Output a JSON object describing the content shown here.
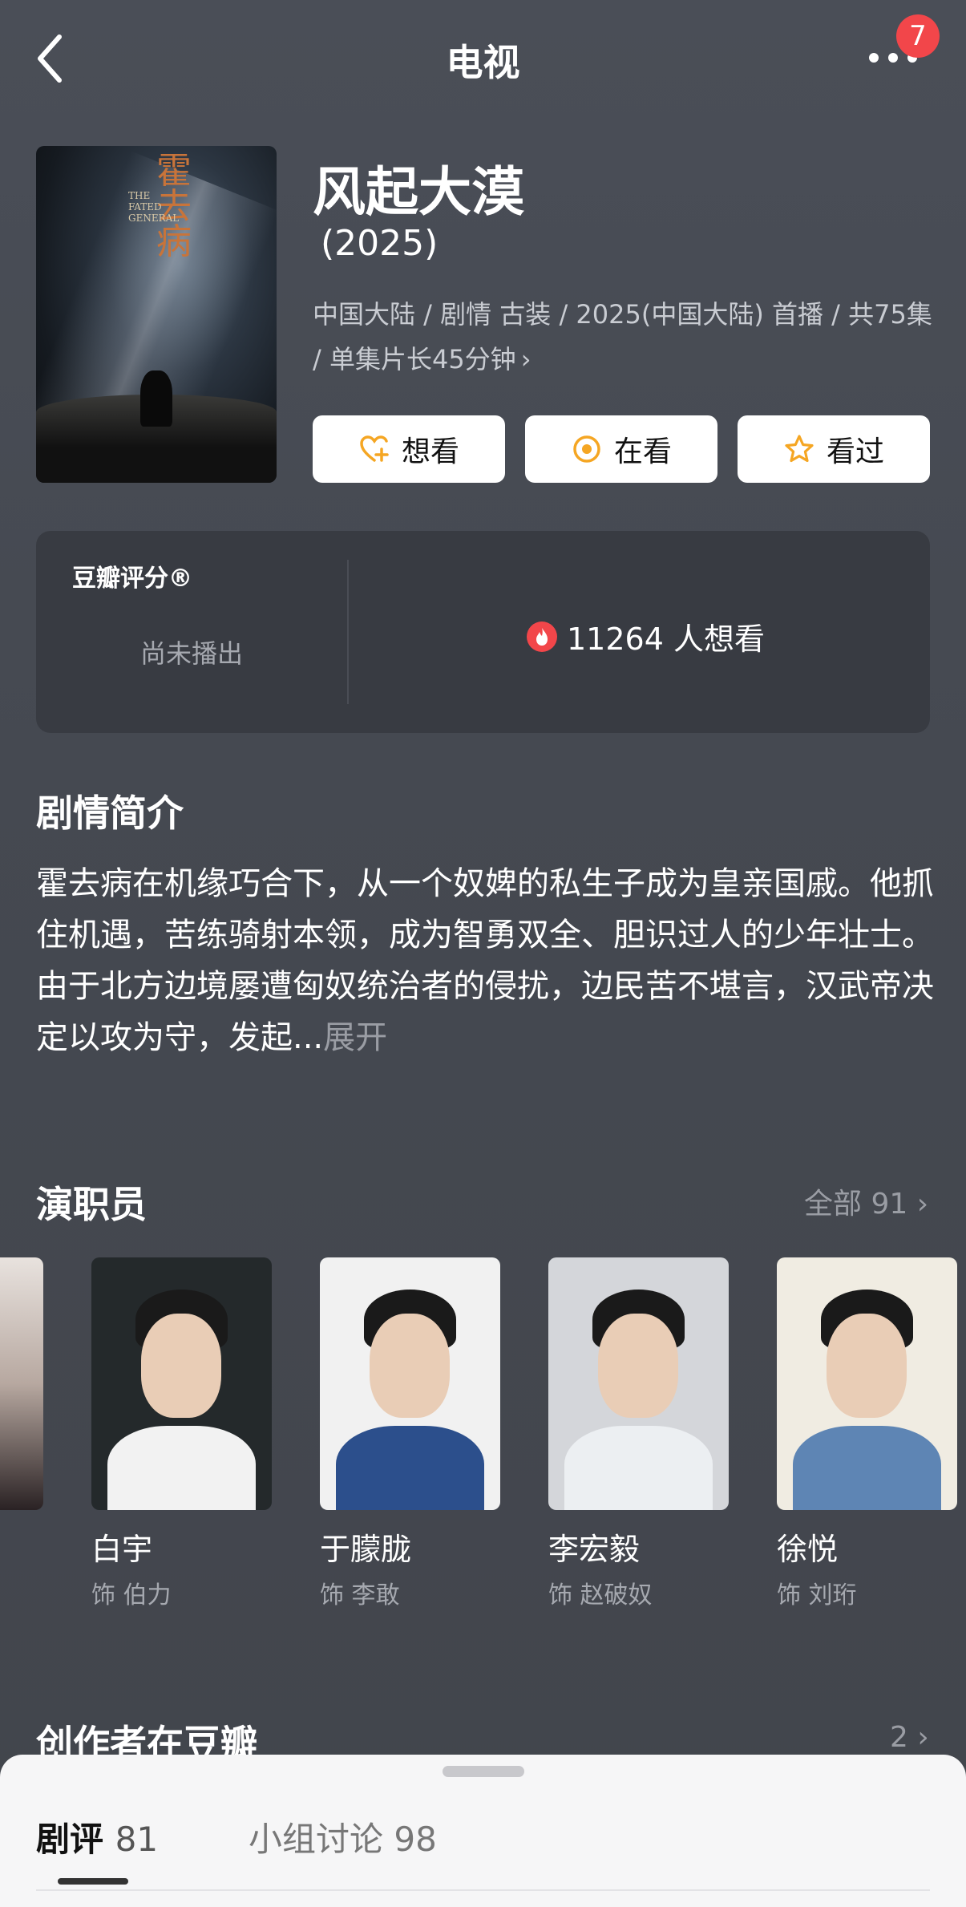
{
  "header": {
    "title": "电视",
    "badge_count": "7"
  },
  "show": {
    "title": "风起大漠",
    "year": " (2025)",
    "meta": "中国大陆 / 剧情 古装 / 2025(中国大陆) 首播 / 共75集 / 单集片长45分钟",
    "poster_calligraphy": "霍去病",
    "poster_english": "THE FATED GENERAL"
  },
  "actions": {
    "want_label": "想看",
    "watching_label": "在看",
    "watched_label": "看过"
  },
  "rating": {
    "label": "豆瓣评分®",
    "status": "尚未播出",
    "want_count_text": "11264 人想看"
  },
  "synopsis": {
    "title": "剧情简介",
    "text": "霍去病在机缘巧合下，从一个奴婢的私生子成为皇亲国戚。他抓住机遇，苦练骑射本领，成为智勇双全、胆识过人的少年壮士。由于北方边境屡遭匈奴统治者的侵扰，边民苦不堪言，汉武帝决定以攻为守，发起...",
    "expand_label": "展开"
  },
  "cast": {
    "title": "演职员",
    "all_label": "全部 91",
    "members": [
      {
        "name": "白宇",
        "role": "饰 伯力"
      },
      {
        "name": "于朦胧",
        "role": "饰 李敢"
      },
      {
        "name": "李宏毅",
        "role": "饰 赵破奴"
      },
      {
        "name": "徐悦",
        "role": "饰 刘珩"
      }
    ]
  },
  "creators": {
    "title": "创作者在豆瓣",
    "count_label": "2"
  },
  "bottom_tabs": {
    "reviews_label": "剧评",
    "reviews_count": "81",
    "group_label": "小组讨论 98"
  },
  "colors": {
    "background": "#474b53",
    "badge": "#f2464a",
    "want_icon": "#f5a623"
  }
}
